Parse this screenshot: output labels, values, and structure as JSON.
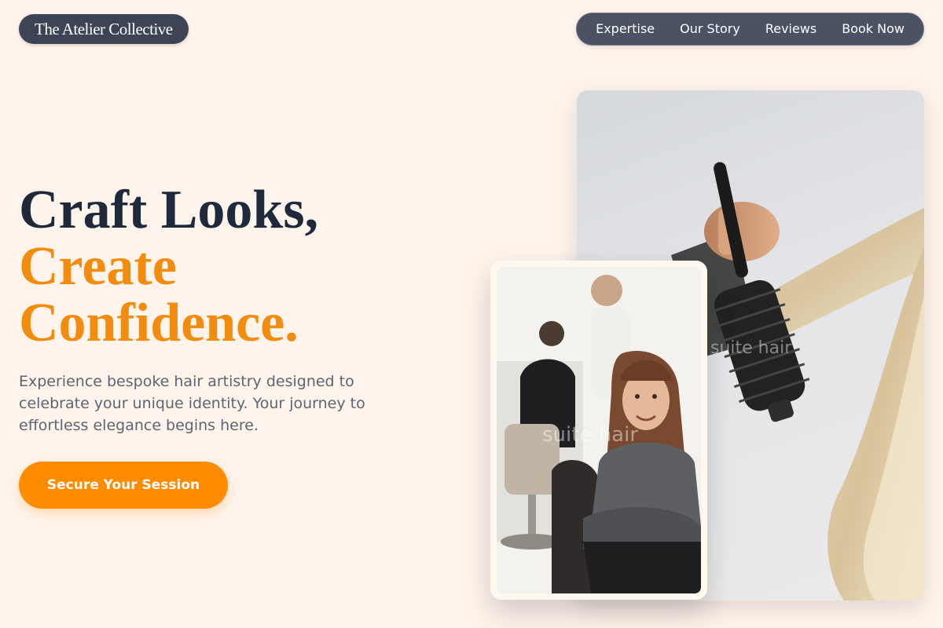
{
  "brand": {
    "name": "The Atelier Collective"
  },
  "nav": {
    "items": [
      {
        "label": "Expertise"
      },
      {
        "label": "Our Story"
      },
      {
        "label": "Reviews"
      },
      {
        "label": "Book Now"
      }
    ]
  },
  "hero": {
    "title_line1": "Craft Looks,",
    "title_line2": "Create",
    "title_line3": "Confidence.",
    "lead": "Experience bespoke hair artistry designed to celebrate your unique identity. Your journey to effortless elegance begins here.",
    "cta_label": "Secure Your Session"
  },
  "images": {
    "main_watermark": "suite hair",
    "small_watermark": "suite hair"
  },
  "colors": {
    "background": "#fff4ec",
    "brand_pill": "#3c4456",
    "nav_pill": "#4a5263",
    "heading": "#1e293b",
    "accent": "#f28c0f",
    "cta": "#ff8c00",
    "body_text": "#5e6472"
  }
}
